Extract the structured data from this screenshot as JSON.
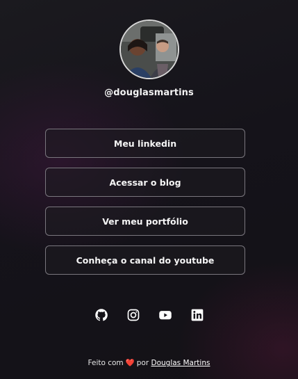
{
  "profile": {
    "handle": "@douglasmartins"
  },
  "links": [
    {
      "label": "Meu linkedin"
    },
    {
      "label": "Acessar o blog"
    },
    {
      "label": "Ver meu portfólio"
    },
    {
      "label": "Conheça o canal do youtube"
    }
  ],
  "socials": [
    {
      "icon": "github-icon"
    },
    {
      "icon": "instagram-icon"
    },
    {
      "icon": "youtube-icon"
    },
    {
      "icon": "linkedin-icon"
    }
  ],
  "footer": {
    "prefix": "Feito com",
    "heart": "❤️",
    "by": "por",
    "author": "Douglas Martins"
  },
  "colors": {
    "background": "#15131a",
    "button_border": "#7a777e",
    "heart": "#e03c3c"
  }
}
